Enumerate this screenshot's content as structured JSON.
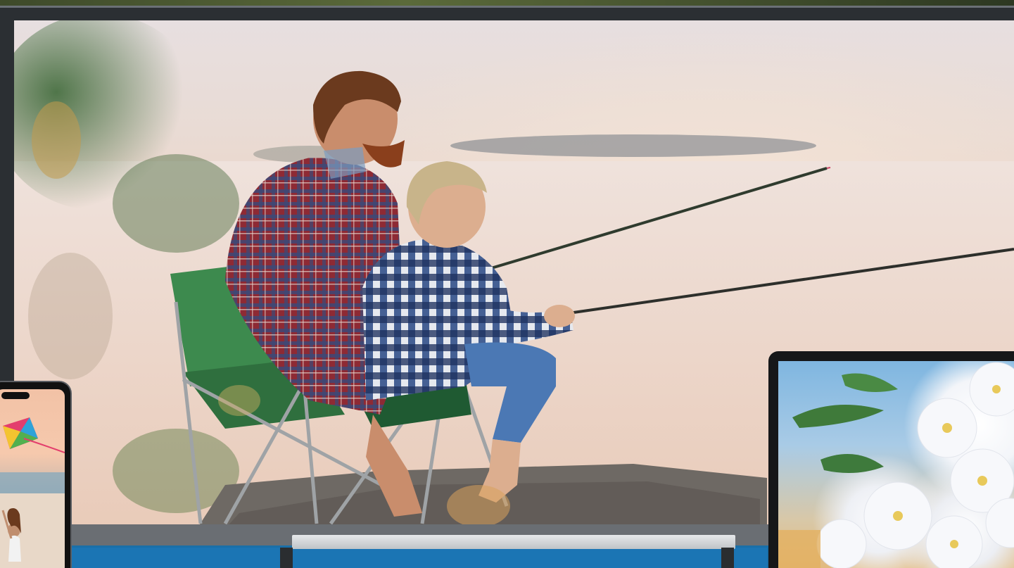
{
  "scene": {
    "description_label": "",
    "devices": [
      "tv",
      "smartphone",
      "tablet"
    ]
  },
  "tv": {
    "image_subject": "father-and-son-fishing",
    "frame_color": "#2b2f33",
    "accent_color": "#1b75b4"
  },
  "phone": {
    "image_subject": "girl-flying-kite"
  },
  "tablet": {
    "image_subject": "white-flowers"
  },
  "colors": {
    "sky": "#e9dbd4",
    "water": "#efd6c7",
    "rock": "#6f6a66",
    "chair": "#3d8a4e",
    "man_shirt": "#9b2f3a",
    "boy_shirt": "#2f4f8a",
    "jeans": "#4b78b4",
    "base_blue": "#1b75b4"
  }
}
